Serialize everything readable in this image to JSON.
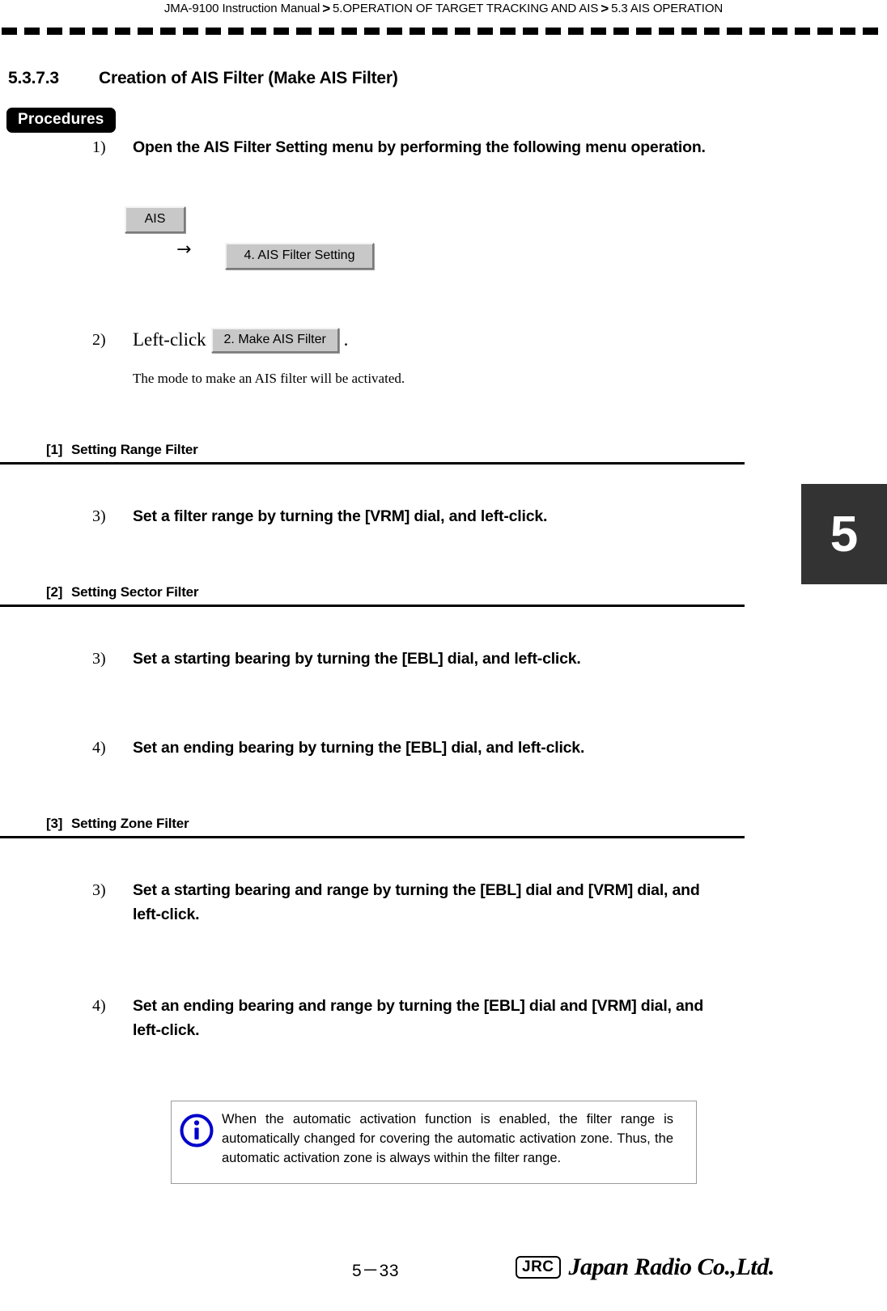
{
  "header": {
    "manual": "JMA-9100 Instruction Manual",
    "sep": ">",
    "chapter": "5.OPERATION OF TARGET TRACKING AND AIS",
    "section": "5.3  AIS OPERATION"
  },
  "section": {
    "number": "5.3.7.3",
    "title": "Creation of AIS Filter (Make AIS Filter)",
    "procedures_label": "Procedures"
  },
  "steps": {
    "s1": {
      "num": "1)",
      "text": "Open the AIS Filter Setting menu by performing the following menu operation."
    },
    "s2": {
      "num": "2)",
      "before": "Left-click",
      "after": ".",
      "note": "The mode to make an AIS filter will be activated."
    }
  },
  "keys": {
    "ais": "AIS",
    "arrow": "→",
    "ais_filter_setting": "4. AIS Filter Setting",
    "make_ais_filter": "2. Make AIS Filter"
  },
  "sections": [
    {
      "tag": "[1]",
      "title": "Setting Range Filter",
      "steps": [
        {
          "num": "3)",
          "text": "Set a filter range by turning the [VRM] dial, and left-click."
        }
      ]
    },
    {
      "tag": "[2]",
      "title": "Setting Sector Filter",
      "steps": [
        {
          "num": "3)",
          "text": "Set a starting bearing by turning the [EBL] dial, and left-click."
        },
        {
          "num": "4)",
          "text": "Set an ending bearing by turning the [EBL] dial, and left-click."
        }
      ]
    },
    {
      "tag": "[3]",
      "title": "Setting Zone Filter",
      "steps": [
        {
          "num": "3)",
          "text": "Set a starting bearing and range by turning the [EBL] dial and [VRM] dial, and left-click."
        },
        {
          "num": "4)",
          "text": "Set an ending bearing and range by turning the [EBL] dial and [VRM] dial, and left-click."
        }
      ]
    }
  ],
  "chapter_tab": "5",
  "info_note": {
    "icon": "info-icon",
    "color": "#0000cc",
    "text": "When the automatic activation function is enabled, the filter range is automatically changed for covering the automatic activation zone. Thus, the automatic activation zone is always within the filter range."
  },
  "footer": {
    "page": "5－33",
    "logo_mark": "JRC",
    "logo_word": "Japan Radio Co.,Ltd."
  }
}
